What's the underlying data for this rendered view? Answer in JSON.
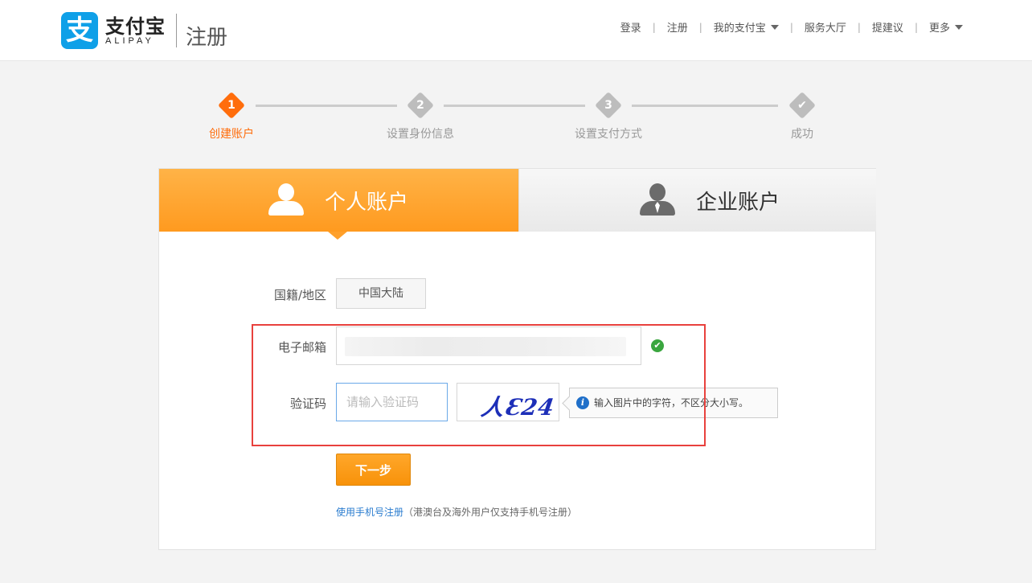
{
  "header": {
    "logo_mark": "支",
    "logo_cn": "支付宝",
    "logo_en": "ALIPAY",
    "page_title": "注册",
    "nav": {
      "login": "登录",
      "register": "注册",
      "my_alipay": "我的支付宝",
      "service_hall": "服务大厅",
      "suggestion": "提建议",
      "more": "更多",
      "separator": "|"
    }
  },
  "steps": [
    {
      "num": "1",
      "label": "创建账户",
      "active": true
    },
    {
      "num": "2",
      "label": "设置身份信息",
      "active": false
    },
    {
      "num": "3",
      "label": "设置支付方式",
      "active": false
    },
    {
      "num": "✔",
      "label": "成功",
      "active": false
    }
  ],
  "tabs": {
    "personal": "个人账户",
    "business": "企业账户"
  },
  "form": {
    "country_label": "国籍/地区",
    "country_value": "中国大陆",
    "email_label": "电子邮箱",
    "email_valid_mark": "✔",
    "captcha_label": "验证码",
    "captcha_placeholder": "请输入验证码",
    "captcha_text": "人Ɛ24",
    "captcha_hint_icon": "i",
    "captcha_hint": "输入图片中的字符，不区分大小写。",
    "next_button": "下一步",
    "phone_link": "使用手机号注册",
    "phone_note": "（港澳台及海外用户仅支持手机号注册）"
  },
  "colors": {
    "accent": "#ff6d0c",
    "tab_orange": "#ffa02a",
    "link_blue": "#2a7ccf",
    "highlight_red": "#e8413d"
  }
}
